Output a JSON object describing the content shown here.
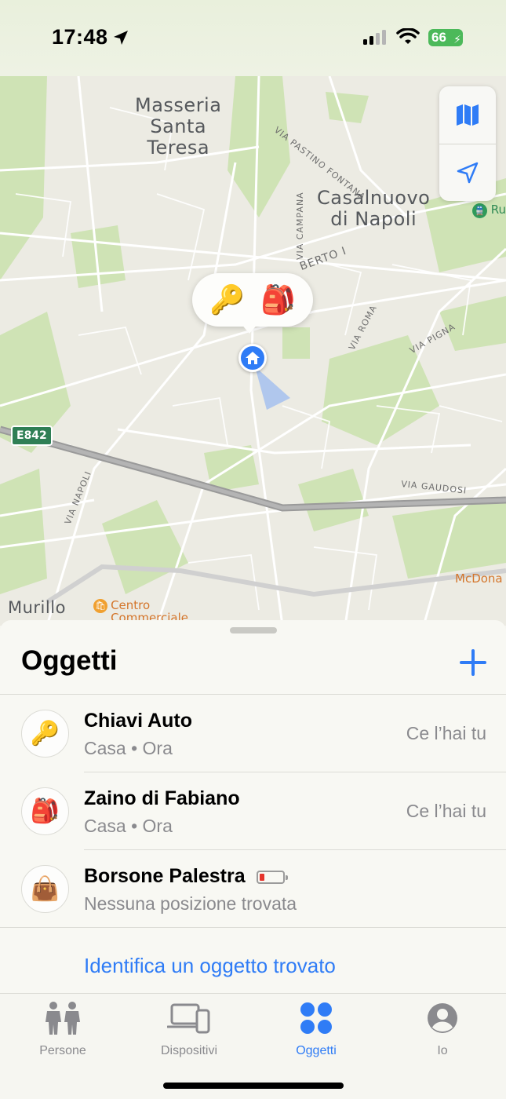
{
  "status_bar": {
    "time": "17:48",
    "battery": "66"
  },
  "map": {
    "places": {
      "masseria": "Masseria\nSanta\nTeresa",
      "casalnuovo": "Casalnuovo\ndi Napoli",
      "murillo": "Murillo"
    },
    "streets": {
      "via_pastino_fontana": "VIA PASTINO FONTANA",
      "via_campana": "VIA CAMPANA",
      "umberto": "BERTO I",
      "via_roma": "VIA ROMA",
      "via_pigna": "VIA PIGNA",
      "via_napoli": "VIA NAPOLI",
      "via_gaudosi": "VIA GAUDOSI"
    },
    "road_shield": "E842",
    "pois": {
      "centro_commerciale": "Centro\nCommerciale\nMeridiana",
      "mcdonalds": "McDona",
      "ru": "Ru"
    },
    "bubble_items": [
      "🔑",
      "🎒"
    ]
  },
  "sheet": {
    "title": "Oggetti",
    "items": [
      {
        "emoji": "🔑",
        "name": "Chiavi Auto",
        "subtitle": "Casa • Ora",
        "status": "Ce l’hai tu"
      },
      {
        "emoji": "🎒",
        "name": "Zaino di Fabiano",
        "subtitle": "Casa • Ora",
        "status": "Ce l’hai tu"
      },
      {
        "emoji": "👜",
        "name": "Borsone Palestra",
        "subtitle": "Nessuna posizione trovata",
        "status": ""
      }
    ],
    "identify_link": "Identifica un oggetto trovato"
  },
  "tabbar": {
    "tabs": [
      {
        "label": "Persone",
        "icon": "people-icon",
        "active": false
      },
      {
        "label": "Dispositivi",
        "icon": "devices-icon",
        "active": false
      },
      {
        "label": "Oggetti",
        "icon": "items-icon",
        "active": true
      },
      {
        "label": "Io",
        "icon": "person-circle-icon",
        "active": false
      }
    ]
  },
  "colors": {
    "accent": "#2f7cf6",
    "battery_green": "#4cb95a",
    "low_battery_red": "#e5342c"
  }
}
